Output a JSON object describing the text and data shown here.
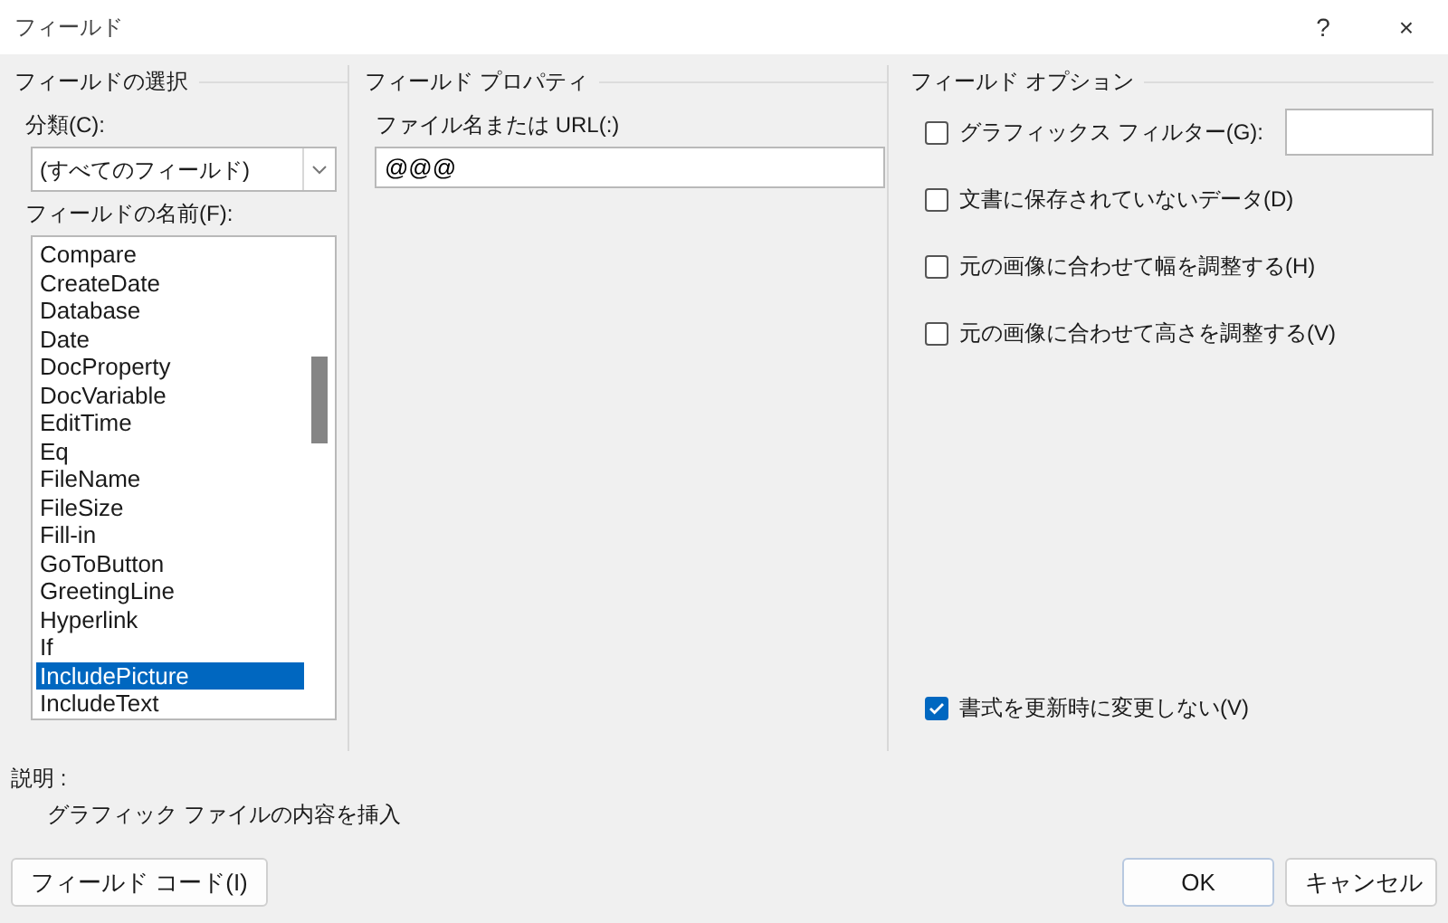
{
  "window": {
    "title": "フィールド",
    "help": "?",
    "close": "×"
  },
  "field_selection": {
    "heading": "フィールドの選択",
    "category_label": "分類(C):",
    "category_value": "(すべてのフィールド)",
    "names_label": "フィールドの名前(F):",
    "names": [
      {
        "label": "Compare",
        "selected": false
      },
      {
        "label": "CreateDate",
        "selected": false
      },
      {
        "label": "Database",
        "selected": false
      },
      {
        "label": "Date",
        "selected": false
      },
      {
        "label": "DocProperty",
        "selected": false
      },
      {
        "label": "DocVariable",
        "selected": false
      },
      {
        "label": "EditTime",
        "selected": false
      },
      {
        "label": "Eq",
        "selected": false
      },
      {
        "label": "FileName",
        "selected": false
      },
      {
        "label": "FileSize",
        "selected": false
      },
      {
        "label": "Fill-in",
        "selected": false
      },
      {
        "label": "GoToButton",
        "selected": false
      },
      {
        "label": "GreetingLine",
        "selected": false
      },
      {
        "label": "Hyperlink",
        "selected": false
      },
      {
        "label": "If",
        "selected": false
      },
      {
        "label": "IncludePicture",
        "selected": true
      },
      {
        "label": "IncludeText",
        "selected": false
      }
    ]
  },
  "field_properties": {
    "heading": "フィールド プロパティ",
    "filename_label": "ファイル名または URL(:)",
    "filename_value": "@@@"
  },
  "field_options": {
    "heading": "フィールド オプション",
    "options": [
      {
        "label": "グラフィックス フィルター(G):",
        "checked": false,
        "kind": "with-input"
      },
      {
        "label": "文書に保存されていないデータ(D)",
        "checked": false,
        "kind": "plain"
      },
      {
        "label": "元の画像に合わせて幅を調整する(H)",
        "checked": false,
        "kind": "plain"
      },
      {
        "label": "元の画像に合わせて高さを調整する(V)",
        "checked": false,
        "kind": "plain"
      }
    ],
    "preserve": {
      "label": "書式を更新時に変更しない(V)",
      "checked": true
    }
  },
  "description": {
    "label": "説明 :",
    "text": "グラフィック ファイルの内容を挿入"
  },
  "buttons": {
    "field_codes": "フィールド コード(I)",
    "ok": "OK",
    "cancel": "キャンセル"
  }
}
